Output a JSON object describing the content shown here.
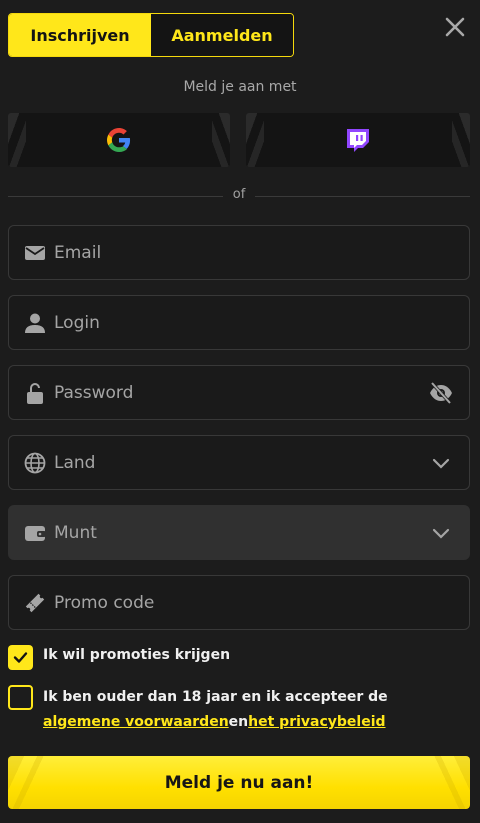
{
  "tabs": {
    "register": "Inschrijven",
    "login": "Aanmelden"
  },
  "social": {
    "title": "Meld je aan met",
    "providers": [
      "google",
      "twitch"
    ]
  },
  "divider_text": "of",
  "fields": {
    "email": "Email",
    "login": "Login",
    "password": "Password",
    "country": "Land",
    "currency": "Munt",
    "promo": "Promo code"
  },
  "checkboxes": {
    "promotions": {
      "label": "Ik wil promoties krijgen",
      "checked": true
    },
    "age": {
      "label": "Ik ben ouder dan 18 jaar en ik accepteer de",
      "checked": false,
      "link1": "algemene voorwaarden",
      "connector": "en",
      "link2": "het privacybeleid"
    }
  },
  "submit_label": "Meld je nu aan!",
  "colors": {
    "accent": "#ffe71a",
    "background": "#1c1c1c",
    "field_border": "#383838"
  }
}
